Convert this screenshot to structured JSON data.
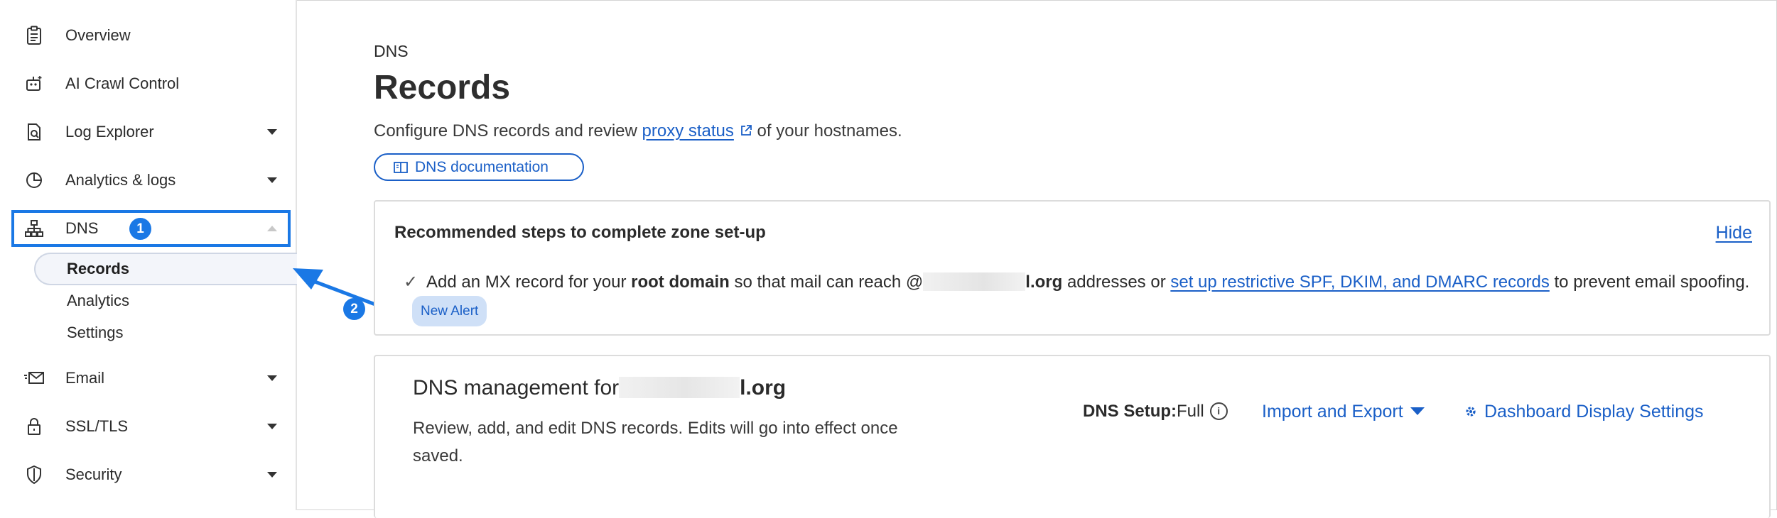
{
  "sidebar": {
    "items": [
      {
        "label": "Overview",
        "icon": "clipboard-icon"
      },
      {
        "label": "AI Crawl Control",
        "icon": "robot-icon"
      },
      {
        "label": "Log Explorer",
        "icon": "document-search-icon"
      },
      {
        "label": "Analytics & logs",
        "icon": "pie-chart-icon"
      },
      {
        "label": "DNS",
        "icon": "network-icon"
      },
      {
        "label": "Email",
        "icon": "email-icon"
      },
      {
        "label": "SSL/TLS",
        "icon": "lock-icon"
      },
      {
        "label": "Security",
        "icon": "shield-icon"
      }
    ],
    "dns_subitems": [
      "Records",
      "Analytics",
      "Settings"
    ]
  },
  "annotations": {
    "step1": "1",
    "step2": "2",
    "highlight_color": "#1a78e5"
  },
  "header": {
    "breadcrumb": "DNS",
    "title": "Records",
    "desc_before": "Configure DNS records and review ",
    "desc_link": "proxy status",
    "desc_after": " of your hostnames.",
    "doc_button": "DNS documentation"
  },
  "recommended": {
    "title": "Recommended steps to complete zone set-up",
    "hide": "Hide",
    "step_text1": "Add an MX record for your ",
    "step_bold": "root domain",
    "step_text2": " so that mail can reach @",
    "step_domain": "l.org",
    "step_text3": " addresses or ",
    "step_link": "set up restrictive SPF, DKIM, and DMARC records",
    "step_text4": " to prevent email spoofing.",
    "badge": "New Alert"
  },
  "management": {
    "title_prefix": "DNS management for",
    "title_domain": "l.org",
    "desc": "Review, add, and edit DNS records. Edits will go into effect once saved.",
    "setup_label": "DNS Setup:",
    "setup_value": "Full",
    "import_export": "Import and Export",
    "display_settings": "Dashboard Display Settings"
  },
  "colors": {
    "link": "#1a5fc7",
    "accent": "#1a78e5"
  }
}
